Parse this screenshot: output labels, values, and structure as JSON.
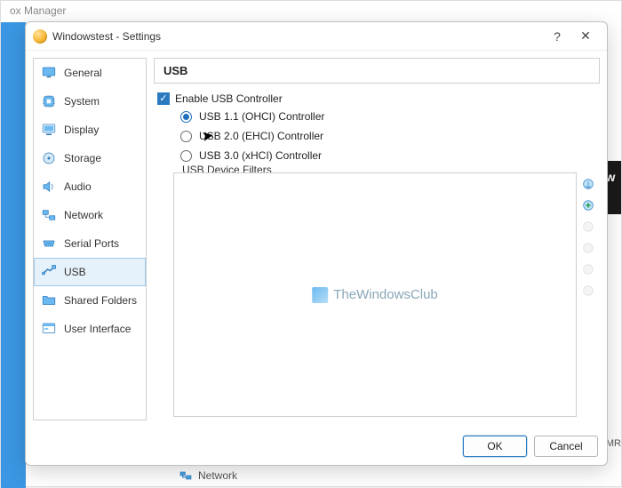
{
  "parent_window": {
    "title_fragment": "ox Manager",
    "right_strip": "ow",
    "oemr": "_OEMR",
    "footer_item": "Network"
  },
  "dialog": {
    "title": "Windowstest - Settings",
    "help_glyph": "?",
    "close_glyph": "✕"
  },
  "categories": [
    {
      "key": "general",
      "label": "General"
    },
    {
      "key": "system",
      "label": "System"
    },
    {
      "key": "display",
      "label": "Display"
    },
    {
      "key": "storage",
      "label": "Storage"
    },
    {
      "key": "audio",
      "label": "Audio"
    },
    {
      "key": "network",
      "label": "Network"
    },
    {
      "key": "serial-ports",
      "label": "Serial Ports"
    },
    {
      "key": "usb",
      "label": "USB",
      "selected": true
    },
    {
      "key": "shared-folders",
      "label": "Shared Folders"
    },
    {
      "key": "user-interface",
      "label": "User Interface"
    }
  ],
  "usb": {
    "section_title": "USB",
    "enable_label": "Enable USB Controller",
    "enable_checked": true,
    "controllers": [
      {
        "label": "USB 1.1 (OHCI) Controller",
        "checked": true
      },
      {
        "label": "USB 2.0 (EHCI) Controller",
        "checked": false
      },
      {
        "label": "USB 3.0 (xHCI) Controller",
        "checked": false
      }
    ],
    "filters_legend": "USB Device Filters",
    "watermark": "TheWindowsClub"
  },
  "buttons": {
    "ok": "OK",
    "cancel": "Cancel"
  }
}
